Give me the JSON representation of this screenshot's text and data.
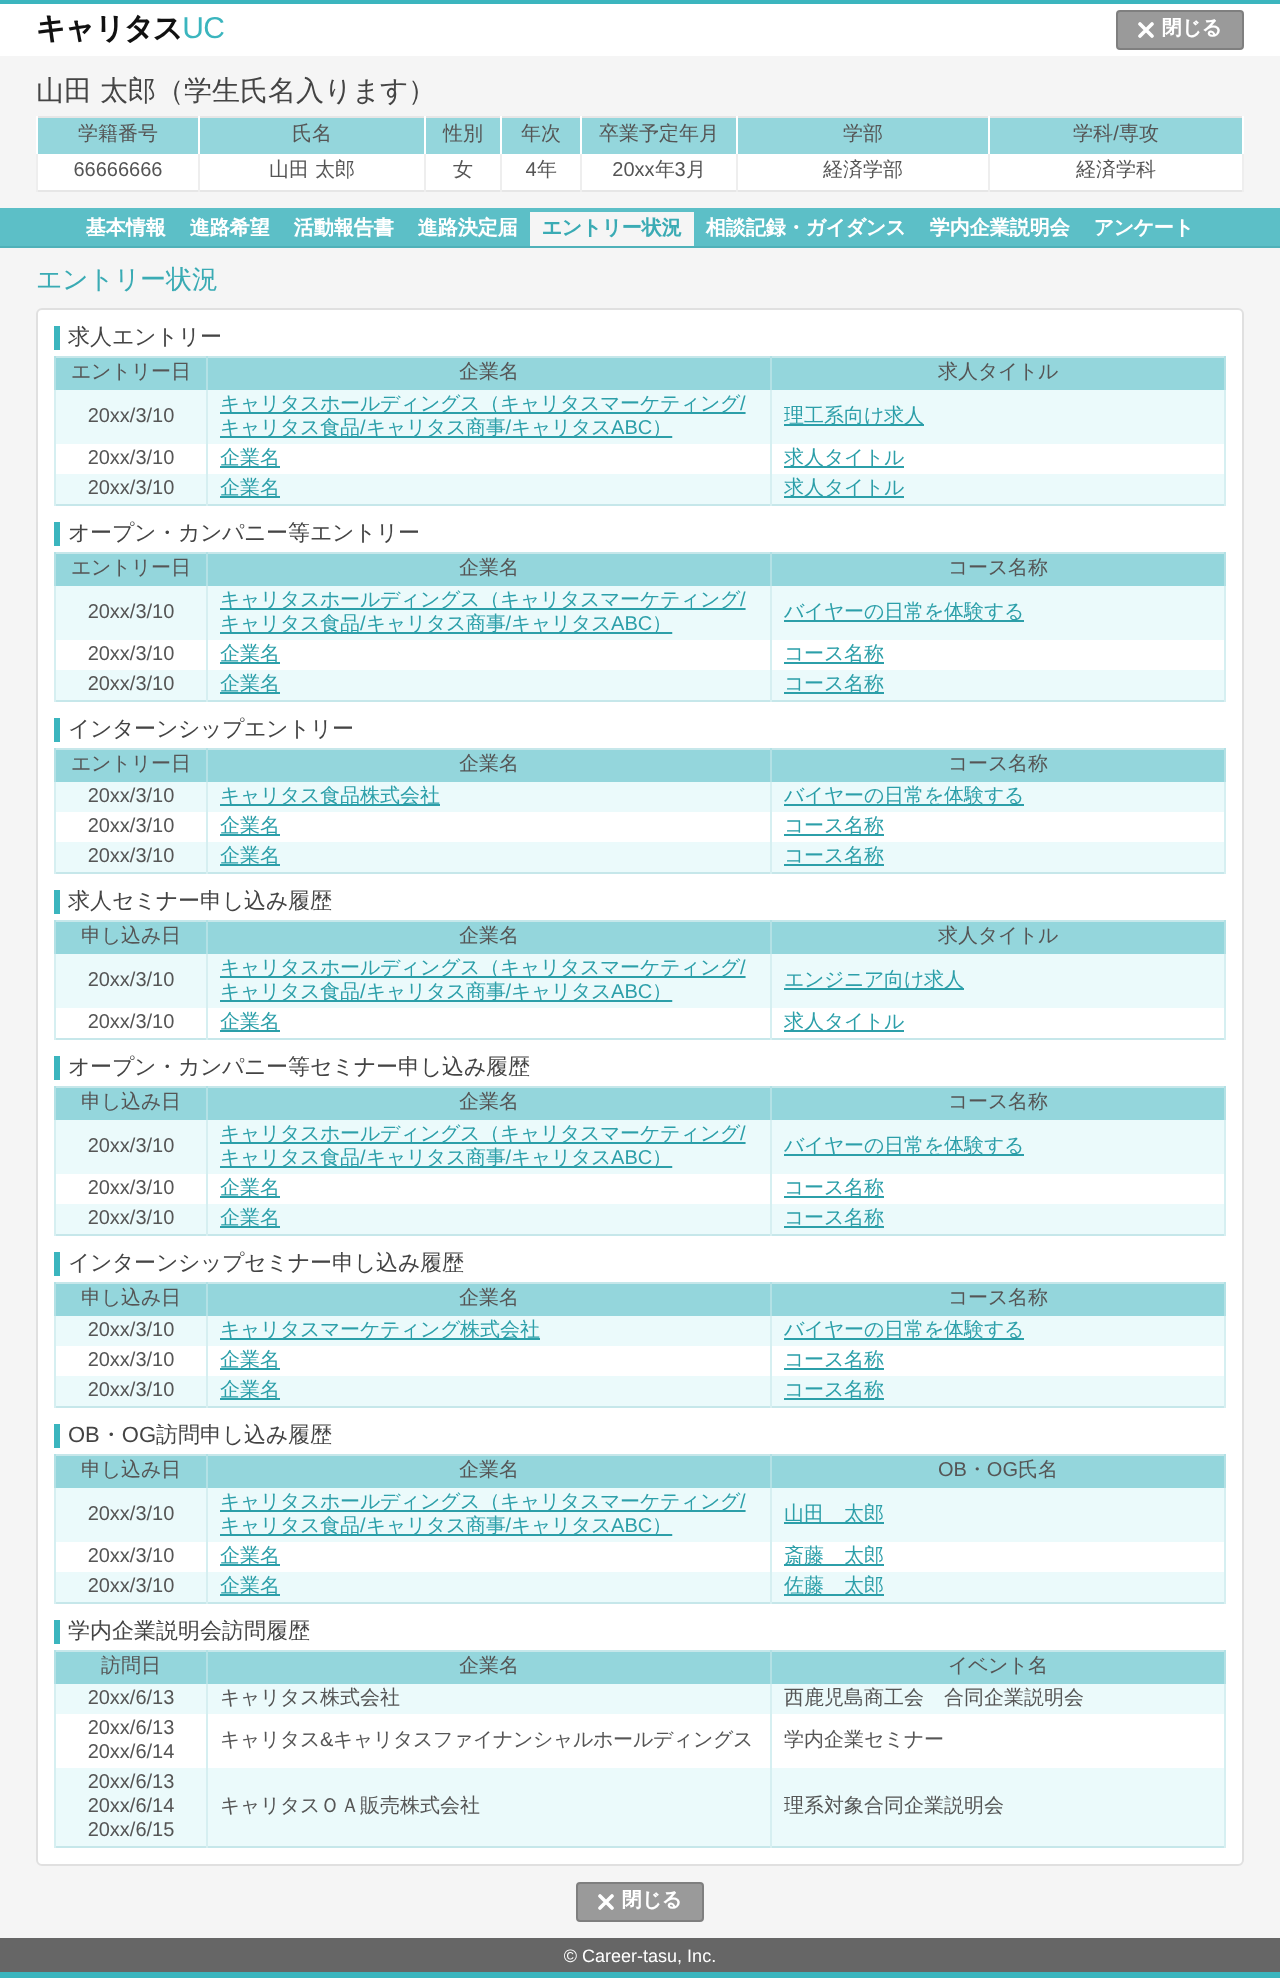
{
  "header": {
    "logo": {
      "name": "キャリタス",
      "accent": "UC"
    },
    "close_button": "閉じる"
  },
  "student": {
    "name_heading": "山田 太郎（学生氏名入ります）",
    "columns": [
      "学籍番号",
      "氏名",
      "性別",
      "年次",
      "卒業予定年月",
      "学部",
      "学科/専攻"
    ],
    "values": [
      "66666666",
      "山田 太郎",
      "女",
      "4年",
      "20xx年3月",
      "経済学部",
      "経済学科"
    ]
  },
  "nav": {
    "tabs": [
      {
        "label": "基本情報",
        "selected": false
      },
      {
        "label": "進路希望",
        "selected": false
      },
      {
        "label": "活動報告書",
        "selected": false
      },
      {
        "label": "進路決定届",
        "selected": false
      },
      {
        "label": "エントリー状況",
        "selected": true
      },
      {
        "label": "相談記録・ガイダンス",
        "selected": false
      },
      {
        "label": "学内企業説明会",
        "selected": false
      },
      {
        "label": "アンケート",
        "selected": false
      }
    ]
  },
  "page_title": "エントリー状況",
  "sections": [
    {
      "title": "求人エントリー",
      "linked": true,
      "columns": [
        "エントリー日",
        "企業名",
        "求人タイトル"
      ],
      "rows": [
        {
          "dates": [
            "20xx/3/10"
          ],
          "company": "キャリタスホールディングス（キャリタスマーケティング/キャリタス食品/キャリタス商事/キャリタスABC）",
          "detail": "理工系向け求人"
        },
        {
          "dates": [
            "20xx/3/10"
          ],
          "company": "企業名",
          "detail": "求人タイトル"
        },
        {
          "dates": [
            "20xx/3/10"
          ],
          "company": "企業名",
          "detail": "求人タイトル"
        }
      ]
    },
    {
      "title": "オープン・カンパニー等エントリー",
      "linked": true,
      "columns": [
        "エントリー日",
        "企業名",
        "コース名称"
      ],
      "rows": [
        {
          "dates": [
            "20xx/3/10"
          ],
          "company": "キャリタスホールディングス（キャリタスマーケティング/キャリタス食品/キャリタス商事/キャリタスABC）",
          "detail": "バイヤーの日常を体験する"
        },
        {
          "dates": [
            "20xx/3/10"
          ],
          "company": "企業名",
          "detail": "コース名称"
        },
        {
          "dates": [
            "20xx/3/10"
          ],
          "company": "企業名",
          "detail": "コース名称"
        }
      ]
    },
    {
      "title": "インターンシップエントリー",
      "linked": true,
      "columns": [
        "エントリー日",
        "企業名",
        "コース名称"
      ],
      "rows": [
        {
          "dates": [
            "20xx/3/10"
          ],
          "company": "キャリタス食品株式会社",
          "detail": "バイヤーの日常を体験する"
        },
        {
          "dates": [
            "20xx/3/10"
          ],
          "company": "企業名",
          "detail": "コース名称"
        },
        {
          "dates": [
            "20xx/3/10"
          ],
          "company": "企業名",
          "detail": "コース名称"
        }
      ]
    },
    {
      "title": "求人セミナー申し込み履歴",
      "linked": true,
      "columns": [
        "申し込み日",
        "企業名",
        "求人タイトル"
      ],
      "rows": [
        {
          "dates": [
            "20xx/3/10"
          ],
          "company": "キャリタスホールディングス（キャリタスマーケティング/キャリタス食品/キャリタス商事/キャリタスABC）",
          "detail": "エンジニア向け求人"
        },
        {
          "dates": [
            "20xx/3/10"
          ],
          "company": "企業名",
          "detail": "求人タイトル"
        }
      ]
    },
    {
      "title": "オープン・カンパニー等セミナー申し込み履歴",
      "linked": true,
      "columns": [
        "申し込み日",
        "企業名",
        "コース名称"
      ],
      "rows": [
        {
          "dates": [
            "20xx/3/10"
          ],
          "company": "キャリタスホールディングス（キャリタスマーケティング/キャリタス食品/キャリタス商事/キャリタスABC）",
          "detail": "バイヤーの日常を体験する"
        },
        {
          "dates": [
            "20xx/3/10"
          ],
          "company": "企業名",
          "detail": "コース名称"
        },
        {
          "dates": [
            "20xx/3/10"
          ],
          "company": "企業名",
          "detail": "コース名称"
        }
      ]
    },
    {
      "title": "インターンシップセミナー申し込み履歴",
      "linked": true,
      "columns": [
        "申し込み日",
        "企業名",
        "コース名称"
      ],
      "rows": [
        {
          "dates": [
            "20xx/3/10"
          ],
          "company": "キャリタスマーケティング株式会社",
          "detail": "バイヤーの日常を体験する"
        },
        {
          "dates": [
            "20xx/3/10"
          ],
          "company": "企業名",
          "detail": "コース名称"
        },
        {
          "dates": [
            "20xx/3/10"
          ],
          "company": "企業名",
          "detail": "コース名称"
        }
      ]
    },
    {
      "title": "OB・OG訪問申し込み履歴",
      "linked": true,
      "columns": [
        "申し込み日",
        "企業名",
        "OB・OG氏名"
      ],
      "rows": [
        {
          "dates": [
            "20xx/3/10"
          ],
          "company": "キャリタスホールディングス（キャリタスマーケティング/キャリタス食品/キャリタス商事/キャリタスABC）",
          "detail": "山田　太郎"
        },
        {
          "dates": [
            "20xx/3/10"
          ],
          "company": "企業名",
          "detail": "斎藤　太郎"
        },
        {
          "dates": [
            "20xx/3/10"
          ],
          "company": "企業名",
          "detail": "佐藤　太郎"
        }
      ]
    },
    {
      "title": "学内企業説明会訪問履歴",
      "linked": false,
      "columns": [
        "訪問日",
        "企業名",
        "イベント名"
      ],
      "rows": [
        {
          "dates": [
            "20xx/6/13"
          ],
          "company": "キャリタス株式会社",
          "detail": "西鹿児島商工会　合同企業説明会"
        },
        {
          "dates": [
            "20xx/6/13",
            "20xx/6/14"
          ],
          "company": "キャリタス&キャリタスファイナンシャルホールディングス",
          "detail": "学内企業セミナー"
        },
        {
          "dates": [
            "20xx/6/13",
            "20xx/6/14",
            "20xx/6/15"
          ],
          "company": "キャリタスＯＡ販売株式会社",
          "detail": "理系対象合同企業説明会"
        }
      ]
    }
  ],
  "bottom_close_button": "閉じる",
  "footer": {
    "copyright": "© Career-tasu, Inc."
  }
}
